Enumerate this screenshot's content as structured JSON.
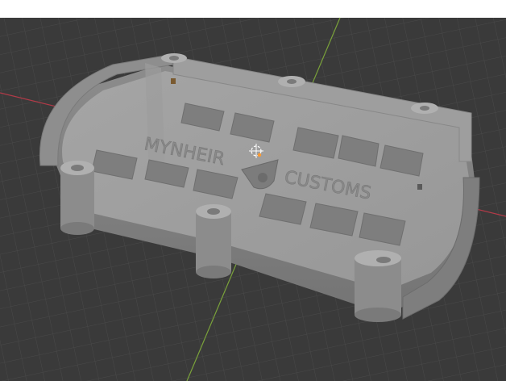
{
  "viewport": {
    "kind": "3d-viewport",
    "background": "#3a3a3a",
    "grid_color": "#4a4a4a",
    "x_axis_color": "#b23a48",
    "y_axis_color": "#7aa23a"
  },
  "model": {
    "base_color": "#9a9a9a",
    "top_color": "#a8a8a8",
    "wall_color": "#8a8a8a",
    "engraving_line1": "MYNHEIR",
    "engraving_line2": "CUSTOMS"
  },
  "origin_marker": {
    "icon": "origin-gizmo-icon"
  },
  "cursor_3d": {
    "icon": "3d-cursor-icon"
  }
}
